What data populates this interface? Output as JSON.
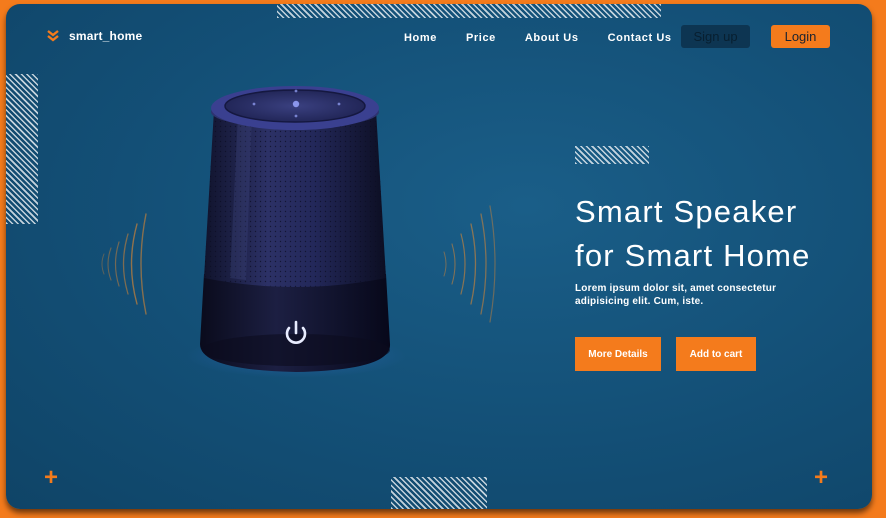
{
  "brand": {
    "name": "smart_home",
    "icon": "chevron-logo-icon"
  },
  "nav": {
    "items": [
      "Home",
      "Price",
      "About Us",
      "Contact Us"
    ]
  },
  "auth": {
    "signup": "Sign up",
    "login": "Login"
  },
  "hero": {
    "title_line1": "Smart Speaker",
    "title_line2": "for Smart Home",
    "description": "Lorem ipsum dolor sit, amet consectetur adipisicing elit. Cum, iste.",
    "more_details": "More Details",
    "add_to_cart": "Add to cart"
  },
  "icons": {
    "power": "power-icon",
    "plus": "plus-icon"
  },
  "colors": {
    "accent": "#f47b1c",
    "background": "#134f76",
    "speaker": "#1f2350",
    "signup_button": "#0d3552"
  }
}
